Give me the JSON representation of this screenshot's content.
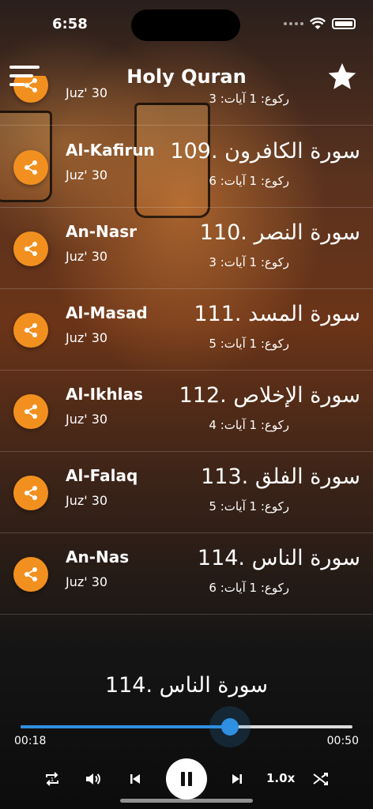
{
  "status_bar": {
    "time": "6:58"
  },
  "header": {
    "title": "Holy Quran",
    "menu_icon": "hamburger-menu-icon",
    "favorite_icon": "star-icon"
  },
  "surahs": [
    {
      "en_name": "",
      "juz": "Juz' 30",
      "ar_name": "",
      "ar_meta": "رکوع: 1 آیات: 3"
    },
    {
      "en_name": "Al-Kafirun",
      "juz": "Juz' 30",
      "ar_name": "109. سورة الكافرون",
      "ar_meta": "رکوع: 1 آیات: 6"
    },
    {
      "en_name": "An-Nasr",
      "juz": "Juz' 30",
      "ar_name": "110. سورة النصر",
      "ar_meta": "رکوع: 1 آیات: 3"
    },
    {
      "en_name": "Al-Masad",
      "juz": "Juz' 30",
      "ar_name": "111. سورة المسد",
      "ar_meta": "رکوع: 1 آیات: 5"
    },
    {
      "en_name": "Al-Ikhlas",
      "juz": "Juz' 30",
      "ar_name": "112. سورة الإخلاص",
      "ar_meta": "رکوع: 1 آیات: 4"
    },
    {
      "en_name": "Al-Falaq",
      "juz": "Juz' 30",
      "ar_name": "113. سورة الفلق",
      "ar_meta": "رکوع: 1 آیات: 5"
    },
    {
      "en_name": "An-Nas",
      "juz": "Juz' 30",
      "ar_name": "114. سورة الناس",
      "ar_meta": "رکوع: 1 آیات: 6"
    }
  ],
  "player": {
    "now_playing": "114. سورة الناس",
    "elapsed": "00:18",
    "duration": "00:50",
    "progress": 0.63,
    "speed": "1.0x",
    "accent_color": "#2f8fe0",
    "share_color": "#f2901f"
  }
}
